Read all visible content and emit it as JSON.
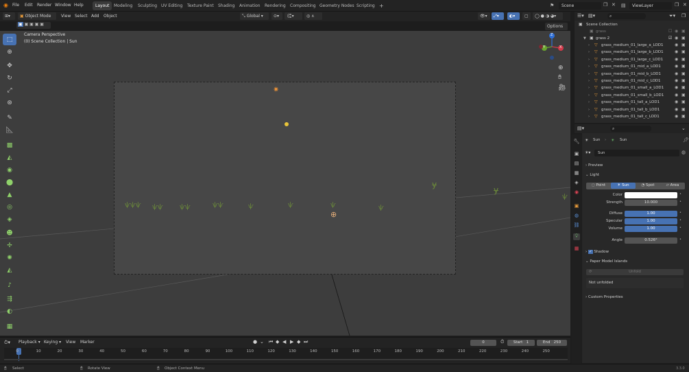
{
  "topbar": {
    "menus": [
      "File",
      "Edit",
      "Render",
      "Window",
      "Help"
    ],
    "workspaces": [
      "Layout",
      "Modeling",
      "Sculpting",
      "UV Editing",
      "Texture Paint",
      "Shading",
      "Animation",
      "Rendering",
      "Compositing",
      "Geometry Nodes",
      "Scripting"
    ],
    "active_workspace": "Layout",
    "add_tab": "+",
    "scene_label": "Scene",
    "view_layer_label": "ViewLayer"
  },
  "viewport_header": {
    "mode": "Object Mode",
    "menus": [
      "View",
      "Select",
      "Add",
      "Object"
    ],
    "transform_orientation": "Global",
    "options": "Options"
  },
  "viewport": {
    "camera_label": "Camera Perspective",
    "collection_label": "(0) Scene Collection | Sun"
  },
  "gizmo": {
    "x": "X",
    "y": "Y",
    "z": "Z"
  },
  "outliner": {
    "root": "Scene Collection",
    "collection_grass": "grass",
    "collection_grass2": "grass 2",
    "items": [
      "grass_medium_01_large_a_LOD1",
      "grass_medium_01_large_b_LOD1",
      "grass_medium_01_large_c_LOD1",
      "grass_medium_01_mid_a_LOD1",
      "grass_medium_01_mid_b_LOD1",
      "grass_medium_01_mid_c_LOD1",
      "grass_medium_01_small_a_LOD1",
      "grass_medium_01_small_b_LOD1",
      "grass_medium_01_tall_a_LOD1",
      "grass_medium_01_tall_b_LOD1",
      "grass_medium_01_tall_c_LOD1"
    ]
  },
  "properties": {
    "breadcrumb_object": "Sun",
    "breadcrumb_data": "Sun",
    "datablock_name": "Sun",
    "preview": "Preview",
    "light": "Light",
    "light_types": [
      "Point",
      "Sun",
      "Spot",
      "Area"
    ],
    "active_light_type": "Sun",
    "color_label": "Color",
    "color_value": "#ffffff",
    "strength_label": "Strength",
    "strength_value": "10.000",
    "diffuse_label": "Diffuse",
    "diffuse_value": "1.00",
    "specular_label": "Specular",
    "specular_value": "1.00",
    "volume_label": "Volume",
    "volume_value": "1.00",
    "angle_label": "Angle",
    "angle_value": "0.526°",
    "shadow": "Shadow",
    "paper_model": "Paper Model Islands",
    "unfold_button": "Unfold",
    "not_unfolded": "Not unfolded",
    "custom_properties": "Custom Properties"
  },
  "timeline": {
    "menus": [
      "Playback",
      "Keying",
      "View",
      "Marker"
    ],
    "current_frame": "0",
    "start_label": "Start",
    "start_value": "1",
    "end_label": "End",
    "end_value": "250",
    "ticks": [
      "0",
      "10",
      "20",
      "30",
      "40",
      "50",
      "60",
      "70",
      "80",
      "90",
      "100",
      "110",
      "120",
      "130",
      "140",
      "150",
      "160",
      "170",
      "180",
      "190",
      "200",
      "210",
      "220",
      "230",
      "240",
      "250"
    ]
  },
  "statusbar": {
    "select": "Select",
    "rotate": "Rotate View",
    "context": "Object Context Menu",
    "version": "3.3.0"
  }
}
